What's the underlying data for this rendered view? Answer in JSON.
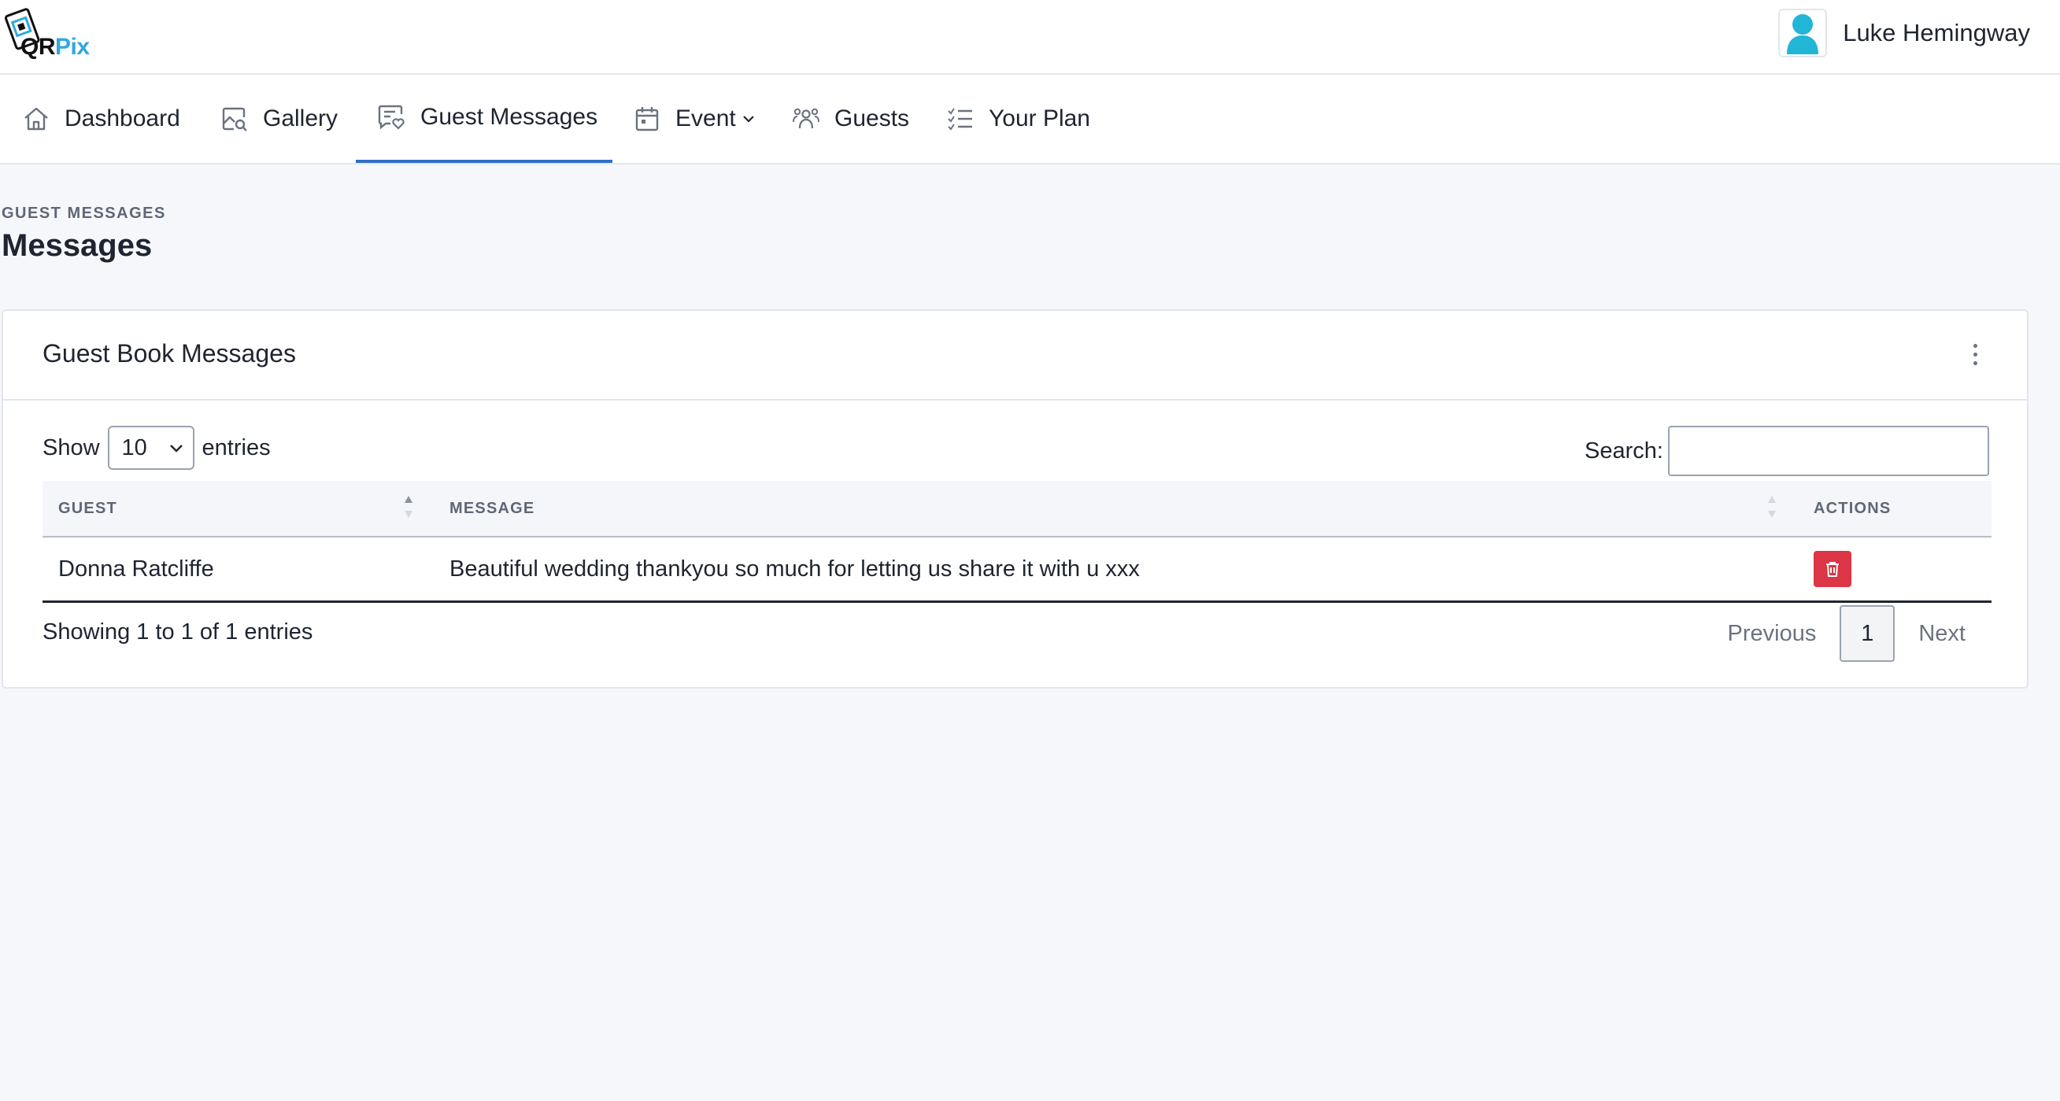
{
  "brand": {
    "logo_qr": "QR",
    "logo_pix": "Pix"
  },
  "user": {
    "name": "Luke Hemingway"
  },
  "nav": [
    {
      "label": "Dashboard",
      "icon": "home-icon"
    },
    {
      "label": "Gallery",
      "icon": "image-search-icon"
    },
    {
      "label": "Guest Messages",
      "icon": "message-heart-icon",
      "active": true
    },
    {
      "label": "Event",
      "icon": "calendar-icon",
      "dropdown": true
    },
    {
      "label": "Guests",
      "icon": "users-icon"
    },
    {
      "label": "Your Plan",
      "icon": "checklist-icon"
    }
  ],
  "page": {
    "breadcrumb": "GUEST MESSAGES",
    "title": "Messages"
  },
  "card": {
    "title": "Guest Book Messages",
    "show_label": "Show",
    "entries_label": "entries",
    "page_size": "10",
    "search_label": "Search:",
    "search_value": "",
    "columns": [
      "GUEST",
      "MESSAGE",
      "ACTIONS"
    ],
    "rows": [
      {
        "guest": "Donna Ratcliffe",
        "message": "Beautiful wedding thankyou so much for letting us share it with u xxx"
      }
    ],
    "info": "Showing 1 to 1 of 1 entries",
    "pagination": {
      "previous": "Previous",
      "current": "1",
      "next": "Next"
    }
  },
  "colors": {
    "accent": "#2f6fc7",
    "danger": "#dc3545",
    "brand_blue": "#2fa8e0",
    "avatar": "#21b5d6"
  }
}
